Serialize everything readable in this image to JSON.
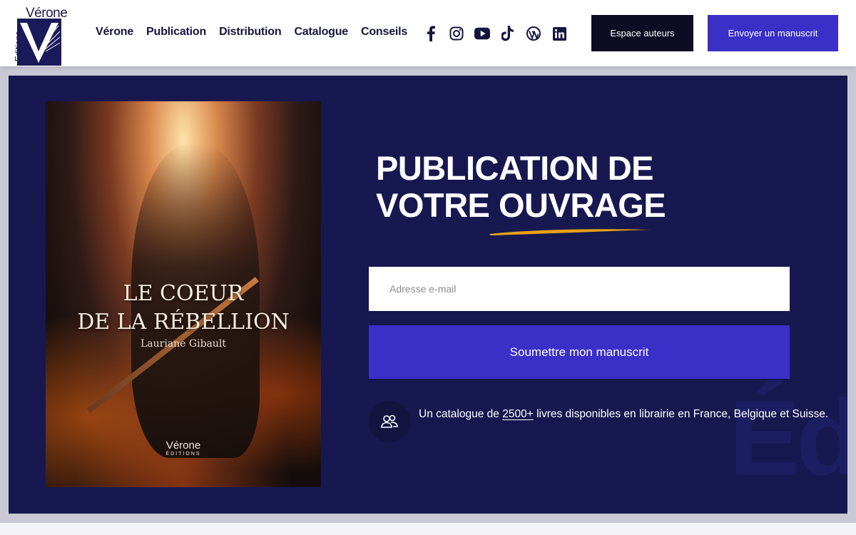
{
  "header": {
    "logo": {
      "brand": "Vérone",
      "sub": "Editions"
    },
    "nav": [
      "Vérone",
      "Publication",
      "Distribution",
      "Catalogue",
      "Conseils"
    ],
    "socials": [
      "facebook-icon",
      "instagram-icon",
      "youtube-icon",
      "tiktok-icon",
      "wordpress-icon",
      "linkedin-icon"
    ],
    "authors_button": "Espace auteurs",
    "send_button": "Envoyer un manuscrit"
  },
  "hero": {
    "cover": {
      "title_line1": "LE COEUR",
      "title_line2": "DE LA RÉBELLION",
      "author": "Lauriane Gibault",
      "publisher": "Vérone",
      "publisher_sub": "ÉDITIONS"
    },
    "headline_line1": "PUBLICATION DE",
    "headline_line2_a": "VOTRE",
    "headline_line2_b": "OUVRAGE",
    "email_placeholder": "Adresse e-mail",
    "submit_label": "Soumettre mon manuscrit",
    "info_prefix": "Un catalogue de",
    "info_count": "2500+",
    "info_suffix": "livres disponibles en librairie en France, Belgique et Suisse.",
    "bg_letters": "Éd"
  },
  "colors": {
    "primary": "#3a2fc7",
    "dark": "#0c0c22",
    "hero_bg": "#17184f",
    "accent_underline": "#e8a317"
  }
}
